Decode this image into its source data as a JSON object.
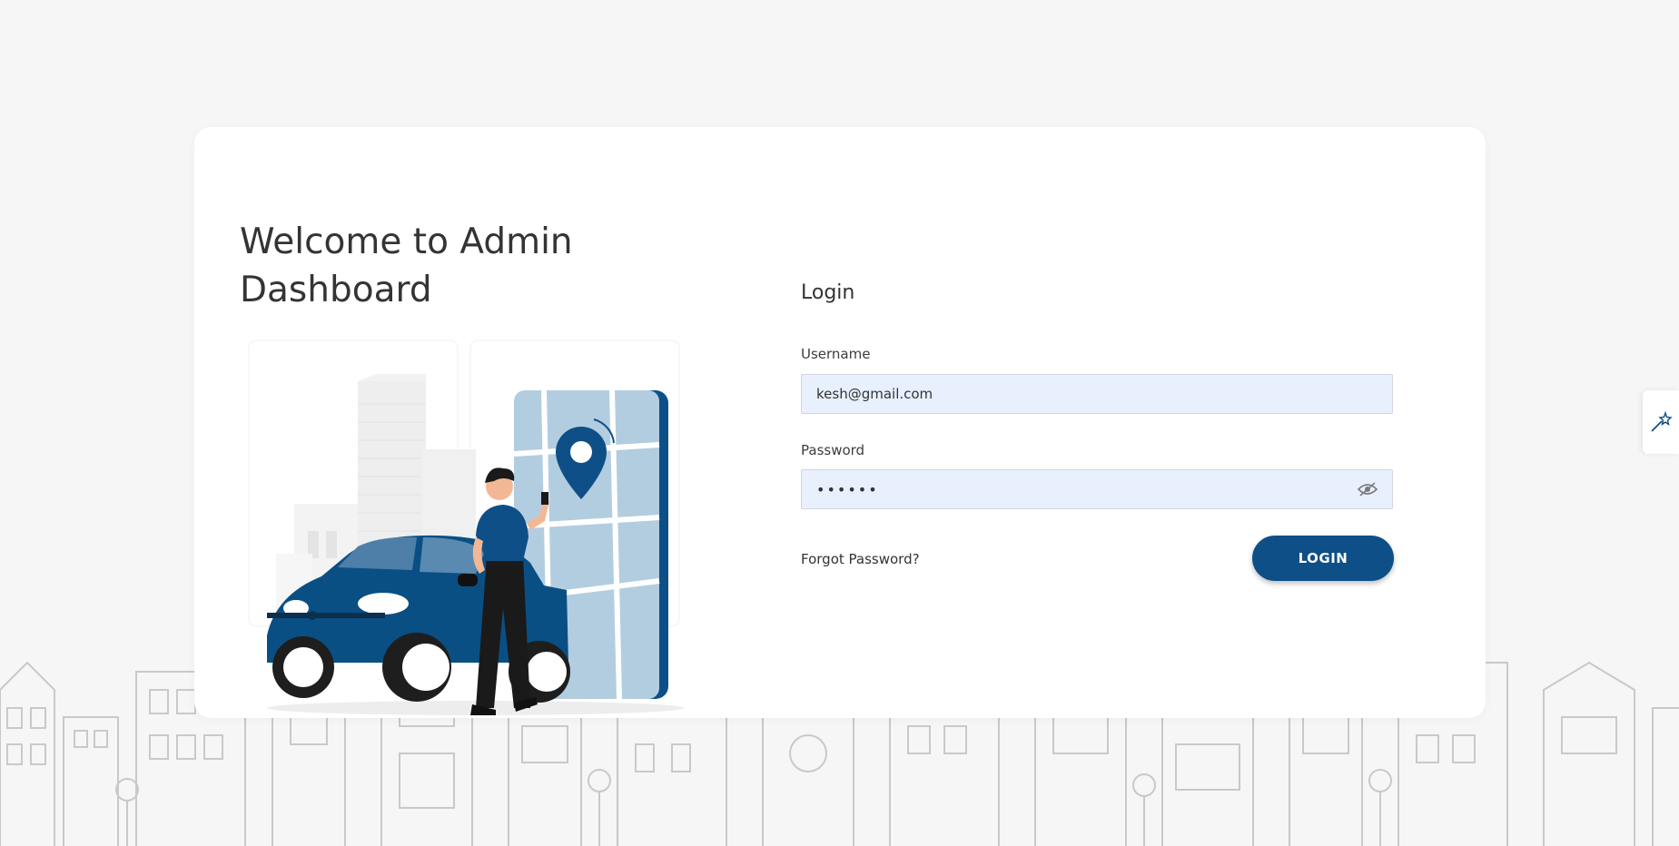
{
  "welcome": {
    "title": "Welcome to Admin Dashboard"
  },
  "login": {
    "title": "Login",
    "username_label": "Username",
    "username_value": "kesh@gmail.com",
    "password_label": "Password",
    "password_value": "••••••",
    "forgot_label": "Forgot Password?",
    "button_label": "LOGIN"
  },
  "icons": {
    "password_toggle": "eye-slash-icon",
    "side_tab": "magic-wand-icon"
  },
  "colors": {
    "primary": "#0e4f87",
    "input_bg": "#e8f0fe",
    "page_bg": "#f6f6f6"
  }
}
